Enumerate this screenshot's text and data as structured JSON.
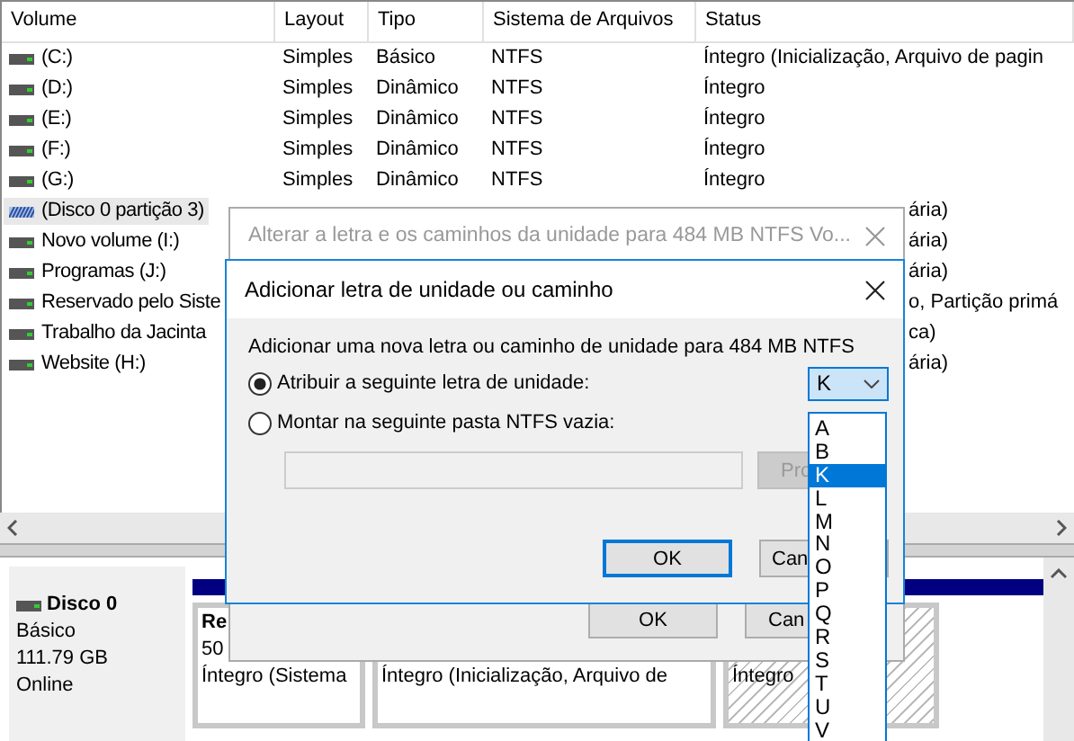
{
  "table": {
    "columns": [
      "Volume",
      "Layout",
      "Tipo",
      "Sistema de Arquivos",
      "Status"
    ],
    "rows": [
      {
        "kind": "drive",
        "volume": "(C:)",
        "layout": "Simples",
        "tipo": "Básico",
        "sistema": "NTFS",
        "status": "Íntegro (Inicialização, Arquivo de pagin",
        "selected": false
      },
      {
        "kind": "drive",
        "volume": "(D:)",
        "layout": "Simples",
        "tipo": "Dinâmico",
        "sistema": "NTFS",
        "status": "Íntegro",
        "selected": false
      },
      {
        "kind": "drive",
        "volume": "(E:)",
        "layout": "Simples",
        "tipo": "Dinâmico",
        "sistema": "NTFS",
        "status": "Íntegro",
        "selected": false
      },
      {
        "kind": "drive",
        "volume": "(F:)",
        "layout": "Simples",
        "tipo": "Dinâmico",
        "sistema": "NTFS",
        "status": "Íntegro",
        "selected": false
      },
      {
        "kind": "drive",
        "volume": "(G:)",
        "layout": "Simples",
        "tipo": "Dinâmico",
        "sistema": "NTFS",
        "status": "Íntegro",
        "selected": false
      },
      {
        "kind": "hatched",
        "volume": "(Disco 0 partição 3)",
        "status": "ária)",
        "selected": true
      },
      {
        "kind": "drive",
        "volume": "Novo volume (I:)",
        "status": "ária)",
        "selected": false
      },
      {
        "kind": "drive",
        "volume": "Programas (J:)",
        "status": "ária)",
        "selected": false
      },
      {
        "kind": "drive",
        "volume": "Reservado pelo Siste",
        "status": "o, Partição primá",
        "selected": false
      },
      {
        "kind": "drive",
        "volume": "Trabalho da Jacinta",
        "status": "ca)",
        "selected": false
      },
      {
        "kind": "drive",
        "volume": "Website (H:)",
        "status": "ária)",
        "selected": false
      }
    ]
  },
  "disk": {
    "name": "Disco 0",
    "type": "Básico",
    "size": "111.79 GB",
    "state": "Online",
    "partitions": [
      {
        "kind": "plain",
        "name": "Re",
        "size": "50",
        "status": "Íntegro (Sistema"
      },
      {
        "kind": "plain",
        "status": "Íntegro (Inicialização, Arquivo de"
      },
      {
        "kind": "hatched",
        "status": "Íntegro"
      }
    ]
  },
  "outer_dialog": {
    "title": "Alterar a letra e os caminhos da unidade para 484 MB NTFS Vo...",
    "buttons": [
      "OK",
      "Can"
    ]
  },
  "inner_dialog": {
    "title": "Adicionar letra de unidade ou caminho",
    "description": "Adicionar uma nova letra ou caminho de unidade para 484 MB NTFS",
    "options": [
      {
        "label": "Atribuir a seguinte letra de unidade:",
        "selected": true
      },
      {
        "label": "Montar na seguinte pasta NTFS vazia:",
        "selected": false
      }
    ],
    "drive_letter": "K",
    "folder_field": {
      "disabled": true
    },
    "browse_button": {
      "label": "Pro",
      "disabled": true
    },
    "buttons": [
      "OK",
      "Can"
    ]
  },
  "dropdown": {
    "items": [
      {
        "label": "A",
        "selected": false
      },
      {
        "label": "B",
        "selected": false
      },
      {
        "label": "K",
        "selected": true
      },
      {
        "label": "L",
        "selected": false
      },
      {
        "label": "M",
        "selected": false
      },
      {
        "label": "N",
        "selected": false
      },
      {
        "label": "O",
        "selected": false
      },
      {
        "label": "P",
        "selected": false
      },
      {
        "label": "Q",
        "selected": false
      },
      {
        "label": "R",
        "selected": false
      },
      {
        "label": "S",
        "selected": false
      },
      {
        "label": "T",
        "selected": false
      },
      {
        "label": "U",
        "selected": false
      },
      {
        "label": "V",
        "selected": false
      }
    ]
  }
}
